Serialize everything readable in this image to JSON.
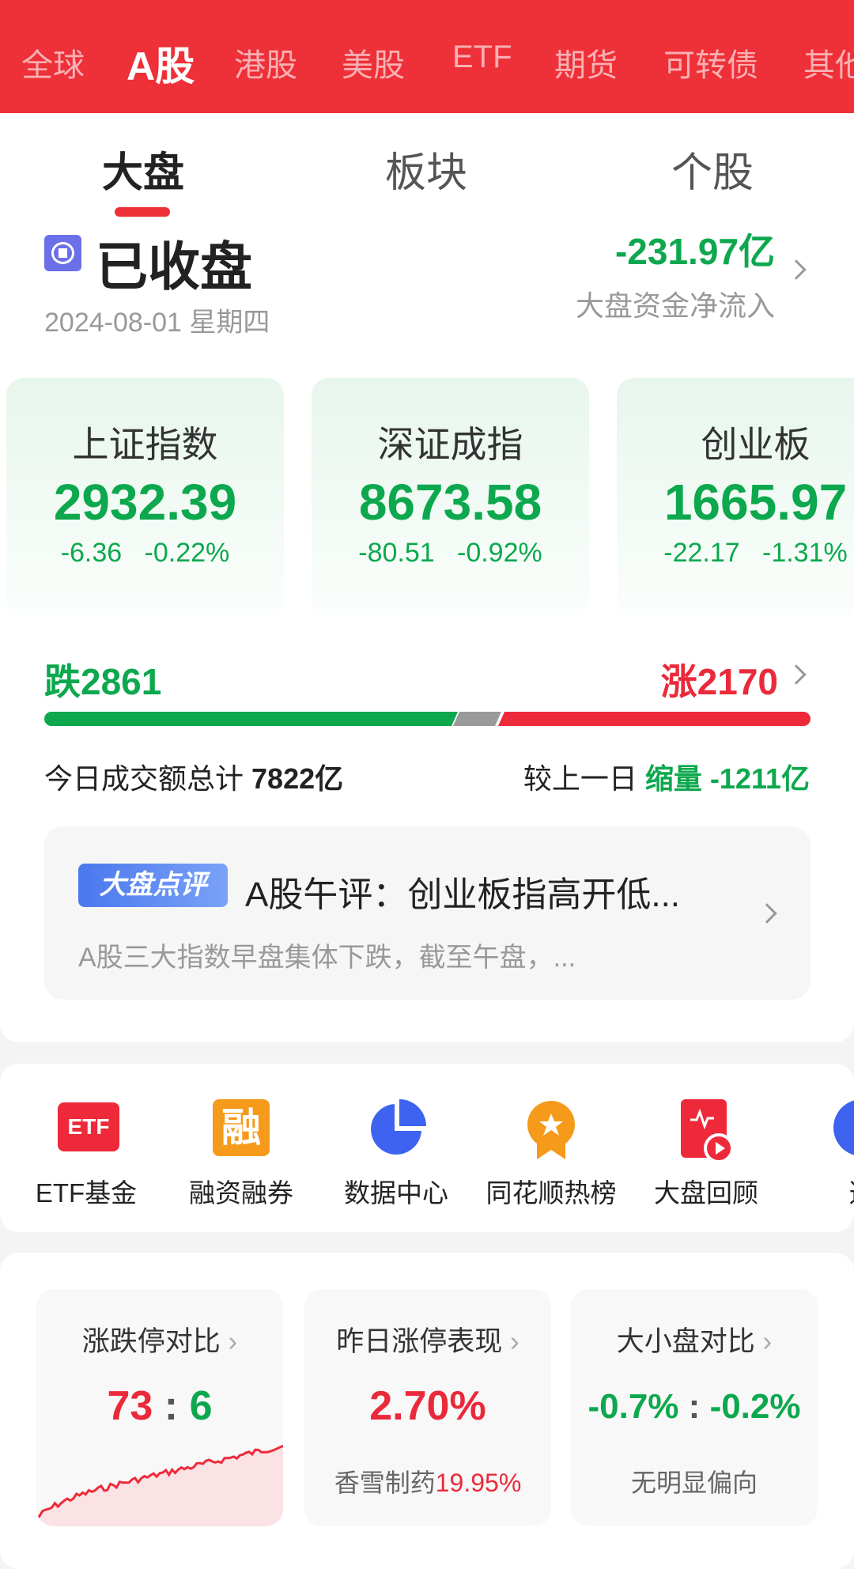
{
  "market_tabs": [
    "全球",
    "A股",
    "港股",
    "美股",
    "ETF",
    "期货",
    "可转债",
    "其他"
  ],
  "active_market_tab": "A股",
  "sub_tabs": [
    "大盘",
    "板块",
    "个股"
  ],
  "active_sub_tab": "大盘",
  "status": {
    "label": "已收盘",
    "date": "2024-08-01 星期四"
  },
  "fund_flow": {
    "value": "-231.97亿",
    "label": "大盘资金净流入"
  },
  "indices": [
    {
      "name": "上证指数",
      "value": "2932.39",
      "change": "-6.36",
      "pct": "-0.22%"
    },
    {
      "name": "深证成指",
      "value": "8673.58",
      "change": "-80.51",
      "pct": "-0.92%"
    },
    {
      "name": "创业板",
      "value": "1665.97",
      "change": "-22.17",
      "pct": "-1.31%"
    }
  ],
  "breadth": {
    "down_label": "跌2861",
    "up_label": "涨2170",
    "down": 2861,
    "up": 2170
  },
  "turnover": {
    "label": "今日成交额总计",
    "value": "7822亿",
    "compare_label": "较上一日",
    "trend": "缩量",
    "delta": "-1211亿"
  },
  "news": {
    "badge": "大盘点评",
    "title": "A股午评：创业板指高开低...",
    "summary": "A股三大指数早盘集体下跌，截至午盘，..."
  },
  "quick_links": [
    {
      "label": "ETF基金",
      "icon": "etf-icon"
    },
    {
      "label": "融资融券",
      "icon": "margin-icon"
    },
    {
      "label": "数据中心",
      "icon": "pie-chart-icon"
    },
    {
      "label": "同花顺热榜",
      "icon": "medal-icon"
    },
    {
      "label": "大盘回顾",
      "icon": "review-play-icon"
    },
    {
      "label": "选",
      "icon": "pick-icon"
    }
  ],
  "stat_cards": [
    {
      "title": "涨跌停对比",
      "up": "73",
      "sep": ":",
      "down": "6"
    },
    {
      "title": "昨日涨停表现",
      "value": "2.70%",
      "sub_name": "香雪制药",
      "sub_value": "19.95%"
    },
    {
      "title": "大小盘对比",
      "left": "-0.7%",
      "sep": ":",
      "right": "-0.2%",
      "sub": "无明显偏向"
    }
  ],
  "colors": {
    "header": "#ee3038",
    "up": "#ea2a3a",
    "down": "#0da84e",
    "flat": "#9a9a9a"
  }
}
